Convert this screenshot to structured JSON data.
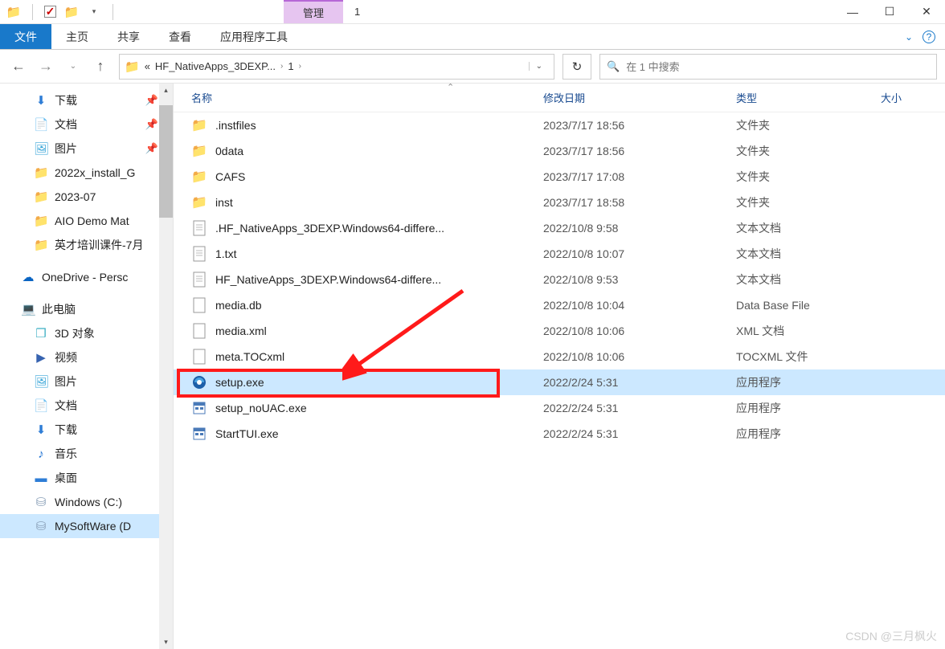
{
  "titlebar": {
    "manage_label": "管理",
    "window_title": "1"
  },
  "ribbon": {
    "file": "文件",
    "home": "主页",
    "share": "共享",
    "view": "查看",
    "app_tools": "应用程序工具"
  },
  "address": {
    "prefix": "«",
    "crumb1": "HF_NativeApps_3DEXP...",
    "crumb2": "1"
  },
  "search": {
    "placeholder": "在 1 中搜索"
  },
  "sidebar": {
    "items": [
      {
        "label": "下载",
        "icon": "⬇",
        "color": "#2e7dd6",
        "pinned": true
      },
      {
        "label": "文档",
        "icon": "📄",
        "color": "#72b0e0",
        "pinned": true
      },
      {
        "label": "图片",
        "icon": "🖼",
        "color": "#3aa6d8",
        "pinned": true
      },
      {
        "label": "2022x_install_G",
        "icon": "📁",
        "color": "#f5c76a"
      },
      {
        "label": "2023-07",
        "icon": "📁",
        "color": "#f5c76a"
      },
      {
        "label": "AIO Demo Mat",
        "icon": "📁",
        "color": "#f5c76a"
      },
      {
        "label": "英才培训课件-7月",
        "icon": "📁",
        "color": "#f5c76a"
      }
    ],
    "onedrive": "OneDrive - Persc",
    "this_pc": "此电脑",
    "pc_items": [
      {
        "label": "3D 对象",
        "icon": "❒",
        "color": "#3fb0c4"
      },
      {
        "label": "视频",
        "icon": "▶",
        "color": "#3763b0"
      },
      {
        "label": "图片",
        "icon": "🖼",
        "color": "#3aa6d8"
      },
      {
        "label": "文档",
        "icon": "📄",
        "color": "#72b0e0"
      },
      {
        "label": "下载",
        "icon": "⬇",
        "color": "#2e7dd6"
      },
      {
        "label": "音乐",
        "icon": "♪",
        "color": "#1b6fd2"
      },
      {
        "label": "桌面",
        "icon": "▬",
        "color": "#2e7dd6"
      },
      {
        "label": "Windows (C:)",
        "icon": "⛁",
        "color": "#8aa0b8"
      },
      {
        "label": "MySoftWare (D",
        "icon": "⛁",
        "color": "#8aa0b8",
        "selected": true
      }
    ]
  },
  "columns": {
    "name": "名称",
    "date": "修改日期",
    "type": "类型",
    "size": "大小"
  },
  "files": [
    {
      "name": ".instfiles",
      "date": "2023/7/17 18:56",
      "type": "文件夹",
      "kind": "folder"
    },
    {
      "name": "0data",
      "date": "2023/7/17 18:56",
      "type": "文件夹",
      "kind": "folder"
    },
    {
      "name": "CAFS",
      "date": "2023/7/17 17:08",
      "type": "文件夹",
      "kind": "folder"
    },
    {
      "name": "inst",
      "date": "2023/7/17 18:58",
      "type": "文件夹",
      "kind": "folder"
    },
    {
      "name": ".HF_NativeApps_3DEXP.Windows64-differe...",
      "date": "2022/10/8 9:58",
      "type": "文本文档",
      "kind": "text"
    },
    {
      "name": "1.txt",
      "date": "2022/10/8 10:07",
      "type": "文本文档",
      "kind": "text"
    },
    {
      "name": "HF_NativeApps_3DEXP.Windows64-differe...",
      "date": "2022/10/8 9:53",
      "type": "文本文档",
      "kind": "text"
    },
    {
      "name": "media.db",
      "date": "2022/10/8 10:04",
      "type": "Data Base File",
      "kind": "generic"
    },
    {
      "name": "media.xml",
      "date": "2022/10/8 10:06",
      "type": "XML 文档",
      "kind": "generic"
    },
    {
      "name": "meta.TOCxml",
      "date": "2022/10/8 10:06",
      "type": "TOCXML 文件",
      "kind": "generic"
    },
    {
      "name": "setup.exe",
      "date": "2022/2/24 5:31",
      "type": "应用程序",
      "kind": "setup",
      "selected": true
    },
    {
      "name": "setup_noUAC.exe",
      "date": "2022/2/24 5:31",
      "type": "应用程序",
      "kind": "exe"
    },
    {
      "name": "StartTUI.exe",
      "date": "2022/2/24 5:31",
      "type": "应用程序",
      "kind": "exe"
    }
  ],
  "watermark": "CSDN @三月枫火"
}
